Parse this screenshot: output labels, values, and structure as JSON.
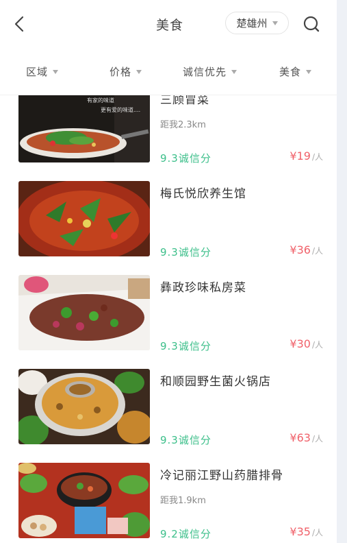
{
  "header": {
    "title": "美食",
    "city": "楚雄州"
  },
  "filters": [
    {
      "label": "区域"
    },
    {
      "label": "价格"
    },
    {
      "label": "诚信优先"
    },
    {
      "label": "美食"
    }
  ],
  "restaurants": [
    {
      "name": "三顾冒菜",
      "distance": "距我2.3km",
      "score": "9.3诚信分",
      "price": "¥19",
      "unit": "/人",
      "image_text_1": "有家的味道",
      "image_text_2": "更有爱的味道...."
    },
    {
      "name": "梅氏悦欣养生馆",
      "distance": "",
      "score": "9.3诚信分",
      "price": "¥36",
      "unit": "/人"
    },
    {
      "name": "彝政珍味私房菜",
      "distance": "",
      "score": "9.3诚信分",
      "price": "¥30",
      "unit": "/人"
    },
    {
      "name": "和顺园野生菌火锅店",
      "distance": "",
      "score": "9.3诚信分",
      "price": "¥63",
      "unit": "/人"
    },
    {
      "name": "冷记丽江野山药腊排骨",
      "distance": "距我1.9km",
      "score": "9.2诚信分",
      "price": "¥35",
      "unit": "/人"
    }
  ]
}
